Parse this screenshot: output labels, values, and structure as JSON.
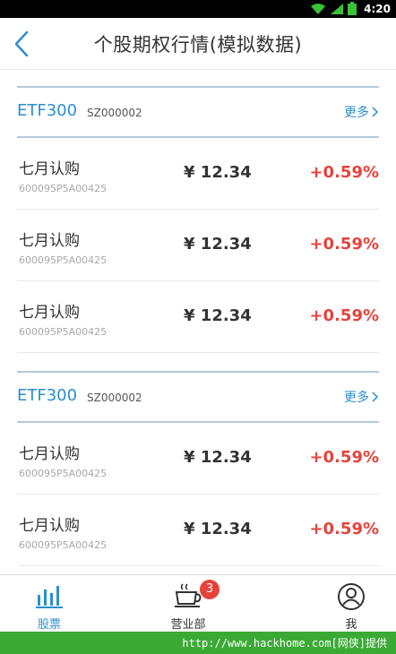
{
  "status_bar": {
    "time": "4:20",
    "icons": [
      "wifi-icon",
      "signal-icon",
      "battery-icon"
    ]
  },
  "header": {
    "back_icon": "chevron-left-icon",
    "title": "个股期权行情(模拟数据)"
  },
  "sections": [
    {
      "name": "ETF300",
      "code": "SZ000002",
      "more_label": "更多",
      "rows": [
        {
          "name": "七月认购",
          "code": "600095P5A00425",
          "price": "¥ 12.34",
          "change": "+0.59%"
        },
        {
          "name": "七月认购",
          "code": "600095P5A00425",
          "price": "¥ 12.34",
          "change": "+0.59%"
        },
        {
          "name": "七月认购",
          "code": "600095P5A00425",
          "price": "¥ 12.34",
          "change": "+0.59%"
        }
      ]
    },
    {
      "name": "ETF300",
      "code": "SZ000002",
      "more_label": "更多",
      "rows": [
        {
          "name": "七月认购",
          "code": "600095P5A00425",
          "price": "¥ 12.34",
          "change": "+0.59%"
        },
        {
          "name": "七月认购",
          "code": "600095P5A00425",
          "price": "¥ 12.34",
          "change": "+0.59%"
        }
      ]
    }
  ],
  "tabbar": {
    "tabs": [
      {
        "label": "股票",
        "icon": "bar-chart-icon",
        "active": true
      },
      {
        "label": "营业部",
        "icon": "coffee-cup-icon",
        "badge": "3"
      },
      {
        "label": "我",
        "icon": "user-icon"
      }
    ]
  },
  "footer": {
    "text": "http://www.hackhome.com[网侠]提供"
  },
  "colors": {
    "accent": "#2a8fcf",
    "up": "#e6423c",
    "footer": "#3aaa35"
  }
}
